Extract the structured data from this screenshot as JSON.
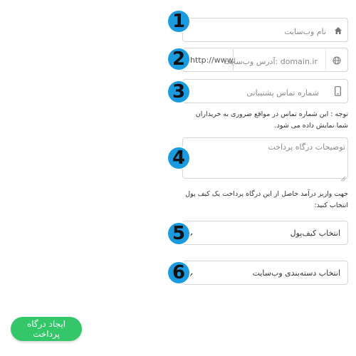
{
  "form": {
    "site_name": {
      "placeholder": "نام وب‌سایت",
      "icon": "home-icon",
      "badge": "1"
    },
    "site_url": {
      "prefix": "http://www.",
      "placeholder": "domain.ir :آدرس وب‌سایت",
      "icon": "globe-icon",
      "badge": "2"
    },
    "support_phone": {
      "placeholder": "شماره تماس پشتیبانی",
      "icon": "mobile-phone-icon",
      "badge": "3"
    },
    "phone_note": "توجه : این شماره تماس در مواقع ضروری به خریداران شما نمایش داده می شود.",
    "description": {
      "placeholder": "توضیحات درگاه پرداخت",
      "badge": "4"
    },
    "wallet_note": "جهت واریز درآمد حاصل از این درگاه پرداخت یک کیف پول انتخاب کنید:",
    "wallet_select": {
      "value": "انتخاب کیف‌پول",
      "badge": "5"
    },
    "category_select": {
      "value": "انتخاب دسته‌بندی وب‌سایت",
      "badge": "6"
    },
    "submit_label": "ایجاد درگاه پرداخت"
  },
  "colors": {
    "badge": "#1a9be0",
    "submit": "#34c76a",
    "border": "#d6d6d6"
  }
}
